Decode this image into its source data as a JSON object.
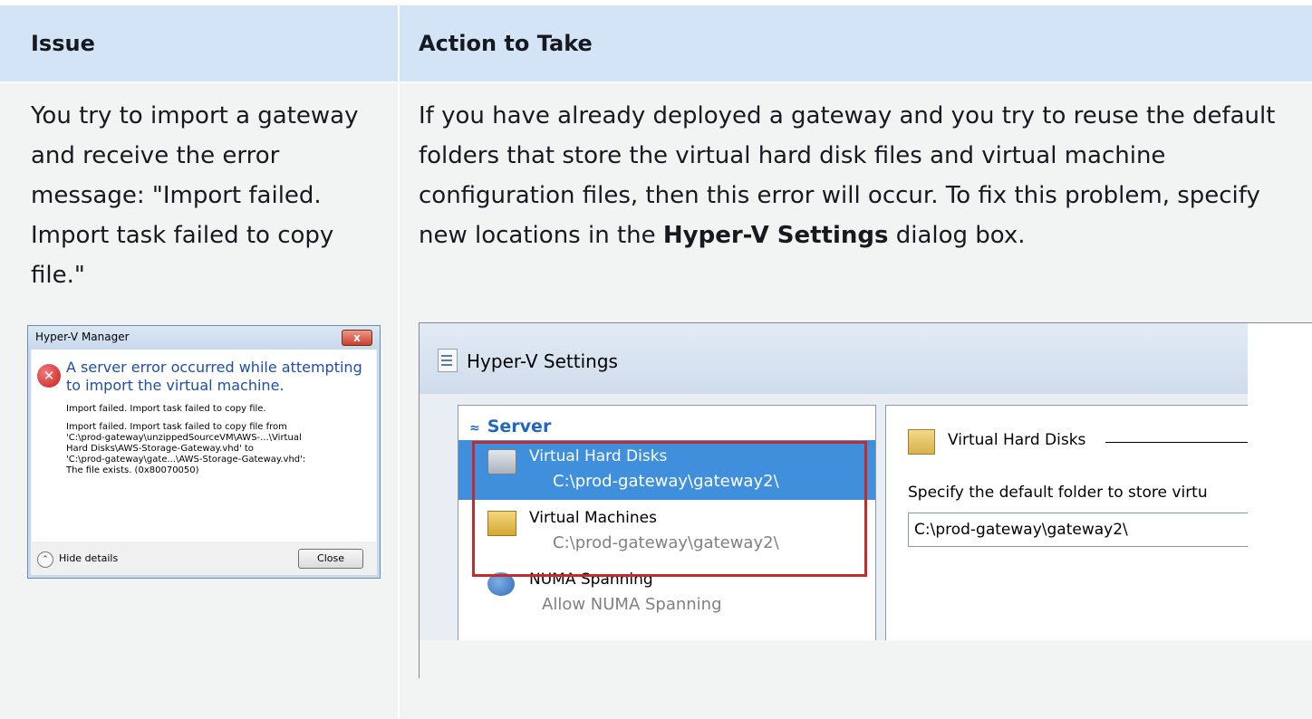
{
  "table": {
    "header_issue": "Issue",
    "header_action": "Action to Take",
    "issue_text": "You try to import a gateway and receive the error message: \"Import failed. Import task failed to copy file.\"",
    "action_pre": "If you have already deployed a gateway and you try to reuse the default folders that store the virtual hard disk files and virtual machine configuration files, then this error will occur. To fix this problem, specify new locations in the ",
    "action_bold": "Hyper-V Settings",
    "action_post": " dialog box."
  },
  "error_dialog": {
    "title": "Hyper-V Manager",
    "close_glyph": "x",
    "icon_glyph": "✕",
    "main_message": "A server error occurred while attempting to import the virtual machine.",
    "line1": "Import failed. Import task failed to copy file.",
    "line2": "Import failed. Import task failed to copy file from\n'C:\\prod-gateway\\unzippedSourceVM\\AWS-...\\Virtual\nHard Disks\\AWS-Storage-Gateway.vhd' to\n'C:\\prod-gateway\\gate...\\AWS-Storage-Gateway.vhd':\nThe file exists. (0x80070050)",
    "hide_details_icon": "⌃",
    "hide_details": "Hide details",
    "close_button": "Close"
  },
  "hyperv": {
    "title": "Hyper-V Settings",
    "server_arrow": "≈",
    "server_label": "Server",
    "items": [
      {
        "label": "Virtual Hard Disks",
        "value": "C:\\prod-gateway\\gateway2\\"
      },
      {
        "label": "Virtual Machines",
        "value": "C:\\prod-gateway\\gateway2\\"
      },
      {
        "label": "NUMA Spanning",
        "value": "Allow NUMA Spanning"
      }
    ],
    "right_heading": "Virtual Hard Disks",
    "right_desc": "Specify the default folder to store virtu",
    "right_input_value": "C:\\prod-gateway\\gateway2\\"
  }
}
